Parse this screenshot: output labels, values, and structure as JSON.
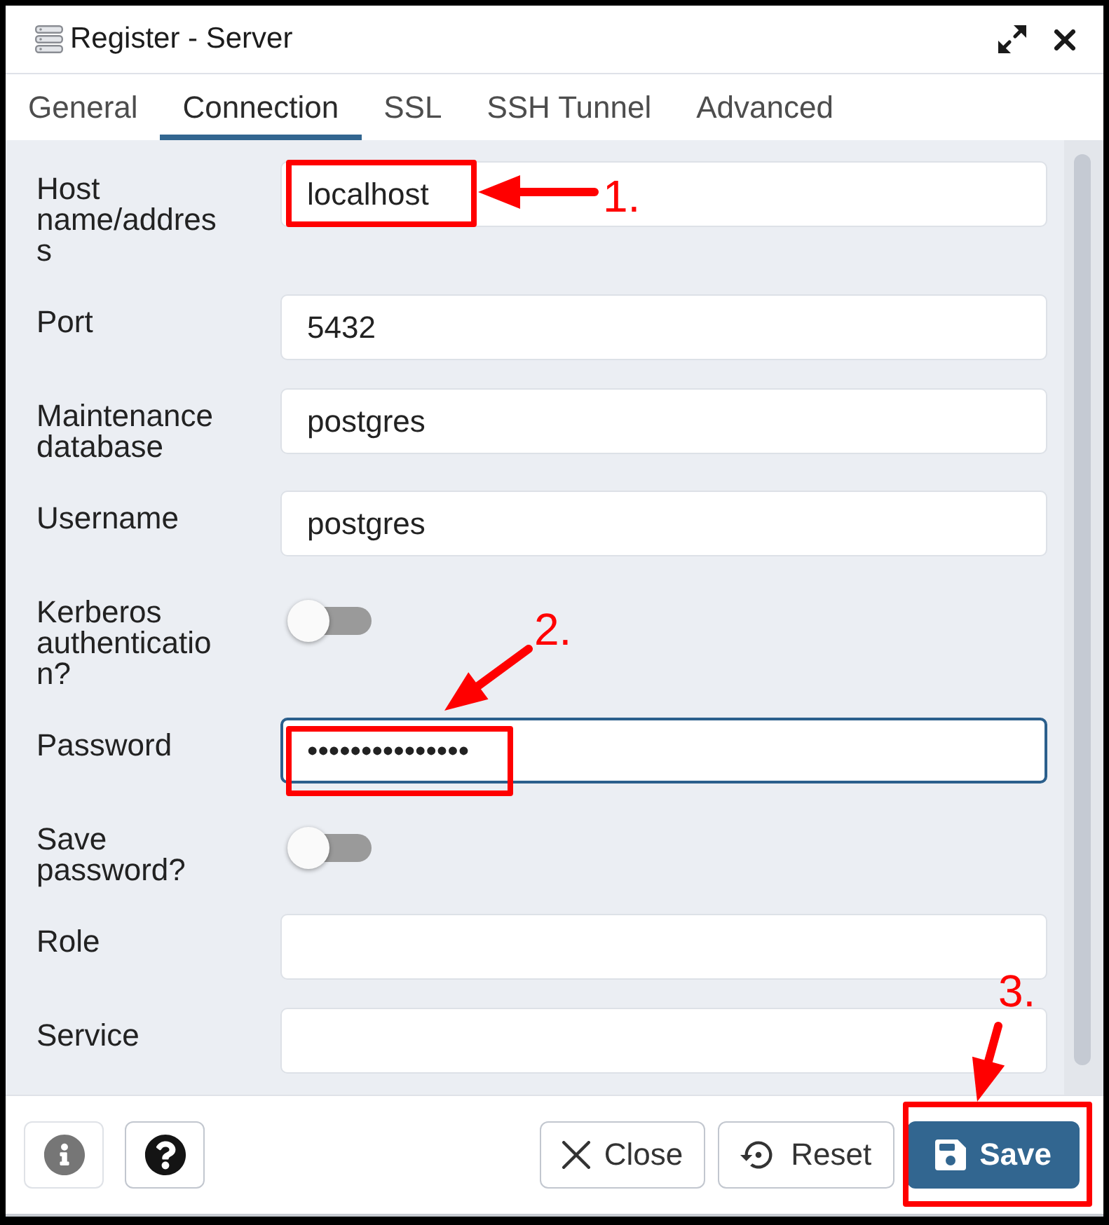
{
  "window": {
    "title": "Register - Server"
  },
  "tabs": [
    {
      "label": "General",
      "selected": false
    },
    {
      "label": "Connection",
      "selected": true
    },
    {
      "label": "SSL",
      "selected": false
    },
    {
      "label": "SSH Tunnel",
      "selected": false
    },
    {
      "label": "Advanced",
      "selected": false
    }
  ],
  "fields": [
    {
      "kind": "text",
      "label": "Host name/address",
      "value": "localhost",
      "focused": false
    },
    {
      "kind": "text",
      "label": "Port",
      "value": "5432",
      "focused": false
    },
    {
      "kind": "text",
      "label": "Maintenance database",
      "value": "postgres",
      "focused": false
    },
    {
      "kind": "text",
      "label": "Username",
      "value": "postgres",
      "focused": false
    },
    {
      "kind": "toggle",
      "label": "Kerberos authentication?",
      "on": false
    },
    {
      "kind": "text",
      "label": "Password",
      "value": "•••••••••••••••",
      "focused": true
    },
    {
      "kind": "toggle",
      "label": "Save password?",
      "on": false
    },
    {
      "kind": "text",
      "label": "Role",
      "focused": false
    },
    {
      "kind": "text",
      "label": "Service",
      "focused": false
    }
  ],
  "footer": {
    "icon_buttons": [
      {
        "kind": "info",
        "disabled": true
      },
      {
        "kind": "help",
        "disabled": false
      }
    ],
    "buttons": [
      {
        "kind": "close",
        "label": "Close",
        "primary": false
      },
      {
        "kind": "reset",
        "label": "Reset",
        "primary": false
      },
      {
        "kind": "save",
        "label": "Save",
        "primary": true
      }
    ]
  },
  "annotations": [
    {
      "number": "1."
    },
    {
      "number": "2."
    },
    {
      "number": "3."
    }
  ]
}
